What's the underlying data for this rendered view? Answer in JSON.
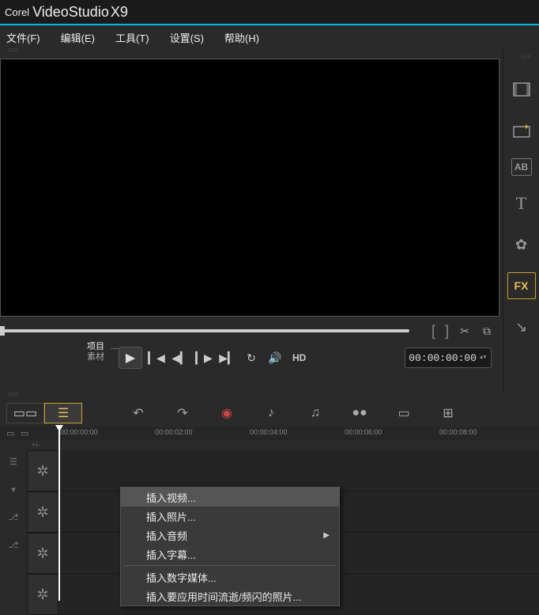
{
  "brand": {
    "corel": "Corel",
    "name": "VideoStudio",
    "ver": "X9"
  },
  "menubar": {
    "file": "文件(F)",
    "edit": "编辑(E)",
    "tools": "工具(T)",
    "settings": "设置(S)",
    "help": "帮助(H)"
  },
  "preview": {
    "mode_project": "项目",
    "mode_clip": "素材",
    "hd": "HD",
    "timecode": "00:00:00:00",
    "bracket_l": "[",
    "bracket_r": "]"
  },
  "side_tools": {
    "media": "media-icon",
    "instant": "instant-project-icon",
    "title_ab": "AB",
    "text": "T",
    "graphic": "graphic-icon",
    "fx": "FX",
    "path": "path-icon"
  },
  "timeline": {
    "ruler": [
      "00:00:00:00",
      "00:00:02:00",
      "00:00:04:00",
      "00:00:06:00",
      "00:00:08:00"
    ],
    "zoom": "+/-"
  },
  "context_menu": {
    "items": [
      {
        "label": "插入视频...",
        "hover": true
      },
      {
        "label": "插入照片..."
      },
      {
        "label": "插入音频",
        "submenu": true
      },
      {
        "label": "插入字幕..."
      },
      {
        "sep": true
      },
      {
        "label": "插入数字媒体..."
      },
      {
        "label": "插入要应用时间流逝/频闪的照片..."
      }
    ]
  }
}
